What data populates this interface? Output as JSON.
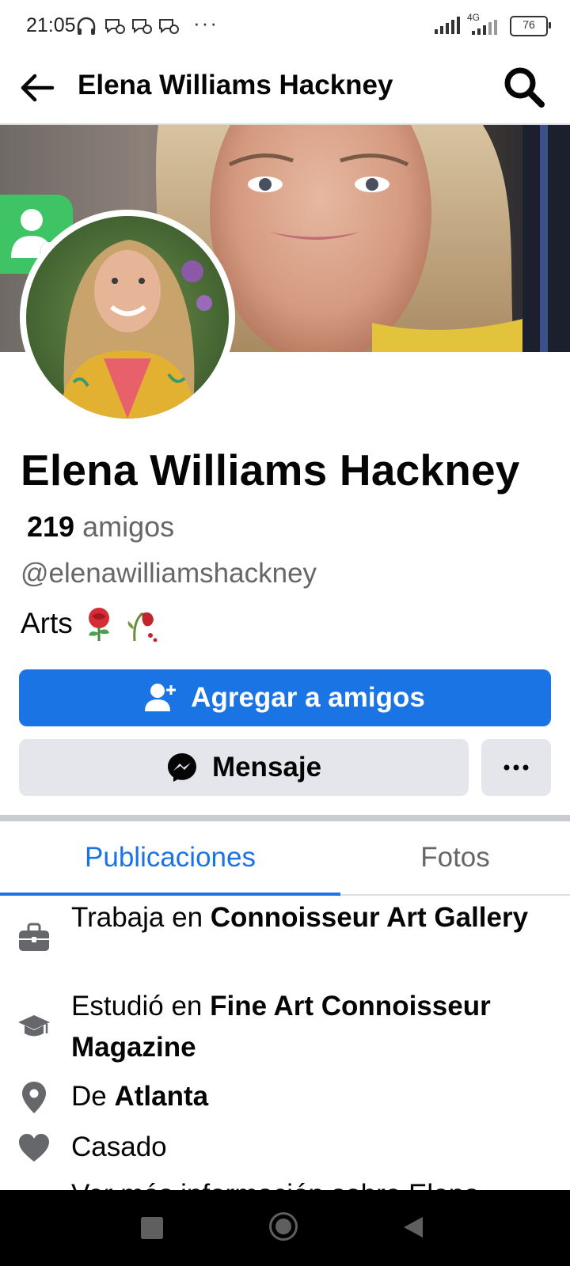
{
  "status_bar": {
    "time": "21:05",
    "more": "···",
    "network": "4G",
    "battery": "76"
  },
  "app_bar": {
    "title": "Elena Williams Hackney"
  },
  "profile": {
    "name": "Elena Williams Hackney",
    "friends_count": "219",
    "friends_label": "amigos",
    "handle": "@elenawilliamshackney",
    "bio_text": "Arts"
  },
  "actions": {
    "add_friend_label": "Agregar a amigos",
    "message_label": "Mensaje"
  },
  "tabs": [
    {
      "label": "Publicaciones",
      "active": true
    },
    {
      "label": "Fotos",
      "active": false
    }
  ],
  "details": {
    "work_prefix": "Trabaja en ",
    "work_place": "Connoisseur Art Gallery",
    "study_prefix": "Estudió en ",
    "study_place": "Fine Art Connoisseur Magazine",
    "from_prefix": "De ",
    "from_place": "Atlanta",
    "relationship": "Casado",
    "see_more": "Ver más información sobre Elena"
  },
  "colors": {
    "accent": "#1b74e4",
    "secondary_button": "#e4e6eb",
    "muted_text": "#65676b"
  },
  "icons": {
    "back": "arrow-left-icon",
    "search": "search-icon",
    "add_friend": "person-add-icon",
    "message": "messenger-icon",
    "more": "more-horizontal-icon",
    "work": "briefcase-icon",
    "study": "graduation-cap-icon",
    "location": "location-pin-icon",
    "relationship": "heart-icon"
  }
}
